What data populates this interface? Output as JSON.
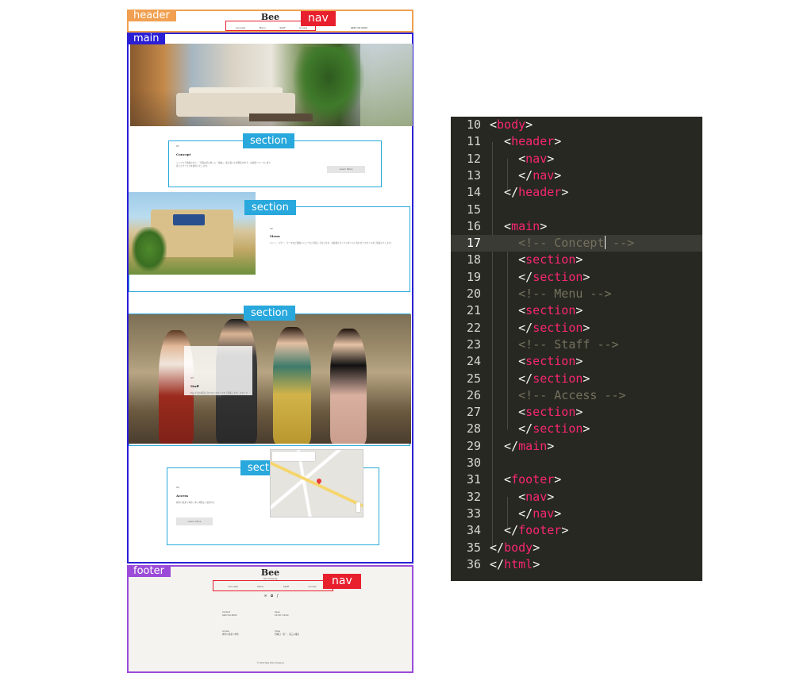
{
  "mockup": {
    "labels": {
      "header": "header",
      "nav": "nav",
      "main": "main",
      "section": "section",
      "footer": "footer"
    },
    "label_colors": {
      "header": "#f0a050",
      "nav": "#e8202e",
      "main": "#2b1fd6",
      "section": "#28a8dc",
      "footer": "#9b4bd8"
    },
    "header": {
      "logo": "Bee",
      "nav_items": [
        "Concept",
        "Menu",
        "Staff",
        "Access"
      ],
      "tel": "0467-00-0000"
    },
    "concept": {
      "label": "01",
      "title": "Concept",
      "text": "シンプルで洗練された、「空間の居心地」と「技術」。落ち着いた雰囲気の中で、お客様一人一人に寄り添ったサービスを提供いたします。",
      "button": "Learn More"
    },
    "menu": {
      "label": "02",
      "title": "Menu",
      "text": "カット、カラー、パーマなど各種メニューをご用意しております。お客様のライフスタイルに合わせたスタイルをご提案いたします。"
    },
    "staff": {
      "label": "03",
      "title": "Staff",
      "text": "Beeではお客様に合わせたスタイルをご提案します。スタッフ一同、心よりお待ちしております。"
    },
    "access": {
      "label": "04",
      "title": "Access",
      "text": "神奈川県茅ヶ崎市 / 茅ヶ崎駅より徒歩5分",
      "button": "Learn More"
    },
    "footer": {
      "logo": "Bee",
      "subtitle": "Hair Dressing",
      "nav_items": [
        "Concept",
        "Menu",
        "Staff",
        "Access"
      ],
      "sns_icons": [
        "twitter-icon",
        "instagram-icon",
        "facebook-icon"
      ],
      "info": {
        "contact_title": "Contact",
        "contact_text": "0467-00-0000",
        "open_title": "Open",
        "open_text": "10:00〜19:00",
        "access_title": "Access",
        "access_text": "神奈川県茅ヶ崎市",
        "close_title": "Close",
        "close_text": "月曜日・第一、第三火曜日"
      },
      "copyright": "© 2019 Bee Hair Dressing"
    }
  },
  "code": {
    "lines": [
      {
        "num": "10",
        "segments": [
          {
            "type": "p",
            "text": "<"
          },
          {
            "type": "t",
            "text": "body"
          },
          {
            "type": "p",
            "text": ">"
          }
        ]
      },
      {
        "num": "11",
        "segments": [
          {
            "type": "p",
            "text": "  <"
          },
          {
            "type": "t",
            "text": "header"
          },
          {
            "type": "p",
            "text": ">"
          }
        ]
      },
      {
        "num": "12",
        "segments": [
          {
            "type": "p",
            "text": "    <"
          },
          {
            "type": "t",
            "text": "nav"
          },
          {
            "type": "p",
            "text": ">"
          }
        ]
      },
      {
        "num": "13",
        "segments": [
          {
            "type": "p",
            "text": "    </"
          },
          {
            "type": "t",
            "text": "nav"
          },
          {
            "type": "p",
            "text": ">"
          }
        ]
      },
      {
        "num": "14",
        "segments": [
          {
            "type": "p",
            "text": "  </"
          },
          {
            "type": "t",
            "text": "header"
          },
          {
            "type": "p",
            "text": ">"
          }
        ]
      },
      {
        "num": "15",
        "segments": []
      },
      {
        "num": "16",
        "segments": [
          {
            "type": "p",
            "text": "  <"
          },
          {
            "type": "t",
            "text": "main"
          },
          {
            "type": "p",
            "text": ">"
          }
        ]
      },
      {
        "num": "17",
        "segments": [
          {
            "type": "c",
            "text": "    <!-- Concept"
          },
          {
            "type": "caret",
            "text": ""
          },
          {
            "type": "c",
            "text": " -->"
          }
        ]
      },
      {
        "num": "18",
        "segments": [
          {
            "type": "p",
            "text": "    <"
          },
          {
            "type": "t",
            "text": "section"
          },
          {
            "type": "p",
            "text": ">"
          }
        ]
      },
      {
        "num": "19",
        "segments": [
          {
            "type": "p",
            "text": "    </"
          },
          {
            "type": "t",
            "text": "section"
          },
          {
            "type": "p",
            "text": ">"
          }
        ]
      },
      {
        "num": "20",
        "segments": [
          {
            "type": "c",
            "text": "    <!-- Menu -->"
          }
        ]
      },
      {
        "num": "21",
        "segments": [
          {
            "type": "p",
            "text": "    <"
          },
          {
            "type": "t",
            "text": "section"
          },
          {
            "type": "p",
            "text": ">"
          }
        ]
      },
      {
        "num": "22",
        "segments": [
          {
            "type": "p",
            "text": "    </"
          },
          {
            "type": "t",
            "text": "section"
          },
          {
            "type": "p",
            "text": ">"
          }
        ]
      },
      {
        "num": "23",
        "segments": [
          {
            "type": "c",
            "text": "    <!-- Staff -->"
          }
        ]
      },
      {
        "num": "24",
        "segments": [
          {
            "type": "p",
            "text": "    <"
          },
          {
            "type": "t",
            "text": "section"
          },
          {
            "type": "p",
            "text": ">"
          }
        ]
      },
      {
        "num": "25",
        "segments": [
          {
            "type": "p",
            "text": "    </"
          },
          {
            "type": "t",
            "text": "section"
          },
          {
            "type": "p",
            "text": ">"
          }
        ]
      },
      {
        "num": "26",
        "segments": [
          {
            "type": "c",
            "text": "    <!-- Access -->"
          }
        ]
      },
      {
        "num": "27",
        "segments": [
          {
            "type": "p",
            "text": "    <"
          },
          {
            "type": "t",
            "text": "section"
          },
          {
            "type": "p",
            "text": ">"
          }
        ]
      },
      {
        "num": "28",
        "segments": [
          {
            "type": "p",
            "text": "    </"
          },
          {
            "type": "t",
            "text": "section"
          },
          {
            "type": "p",
            "text": ">"
          }
        ]
      },
      {
        "num": "29",
        "segments": [
          {
            "type": "p",
            "text": "  </"
          },
          {
            "type": "t",
            "text": "main"
          },
          {
            "type": "p",
            "text": ">"
          }
        ]
      },
      {
        "num": "30",
        "segments": []
      },
      {
        "num": "31",
        "segments": [
          {
            "type": "p",
            "text": "  <"
          },
          {
            "type": "t",
            "text": "footer"
          },
          {
            "type": "p",
            "text": ">"
          }
        ]
      },
      {
        "num": "32",
        "segments": [
          {
            "type": "p",
            "text": "    <"
          },
          {
            "type": "t",
            "text": "nav"
          },
          {
            "type": "p",
            "text": ">"
          }
        ]
      },
      {
        "num": "33",
        "segments": [
          {
            "type": "p",
            "text": "    </"
          },
          {
            "type": "t",
            "text": "nav"
          },
          {
            "type": "p",
            "text": ">"
          }
        ]
      },
      {
        "num": "34",
        "segments": [
          {
            "type": "p",
            "text": "  </"
          },
          {
            "type": "t",
            "text": "footer"
          },
          {
            "type": "p",
            "text": ">"
          }
        ]
      },
      {
        "num": "35",
        "segments": [
          {
            "type": "p",
            "text": "</"
          },
          {
            "type": "t",
            "text": "body"
          },
          {
            "type": "p",
            "text": ">"
          }
        ]
      },
      {
        "num": "36",
        "segments": [
          {
            "type": "p",
            "text": "</"
          },
          {
            "type": "t",
            "text": "html"
          },
          {
            "type": "p",
            "text": ">"
          }
        ]
      }
    ],
    "cursor_line": "17",
    "colors": {
      "background": "#272822",
      "tag": "#f92672",
      "punctuation": "#f8f8f2",
      "comment": "#75715e",
      "line_number": "#d6d6d0"
    }
  }
}
